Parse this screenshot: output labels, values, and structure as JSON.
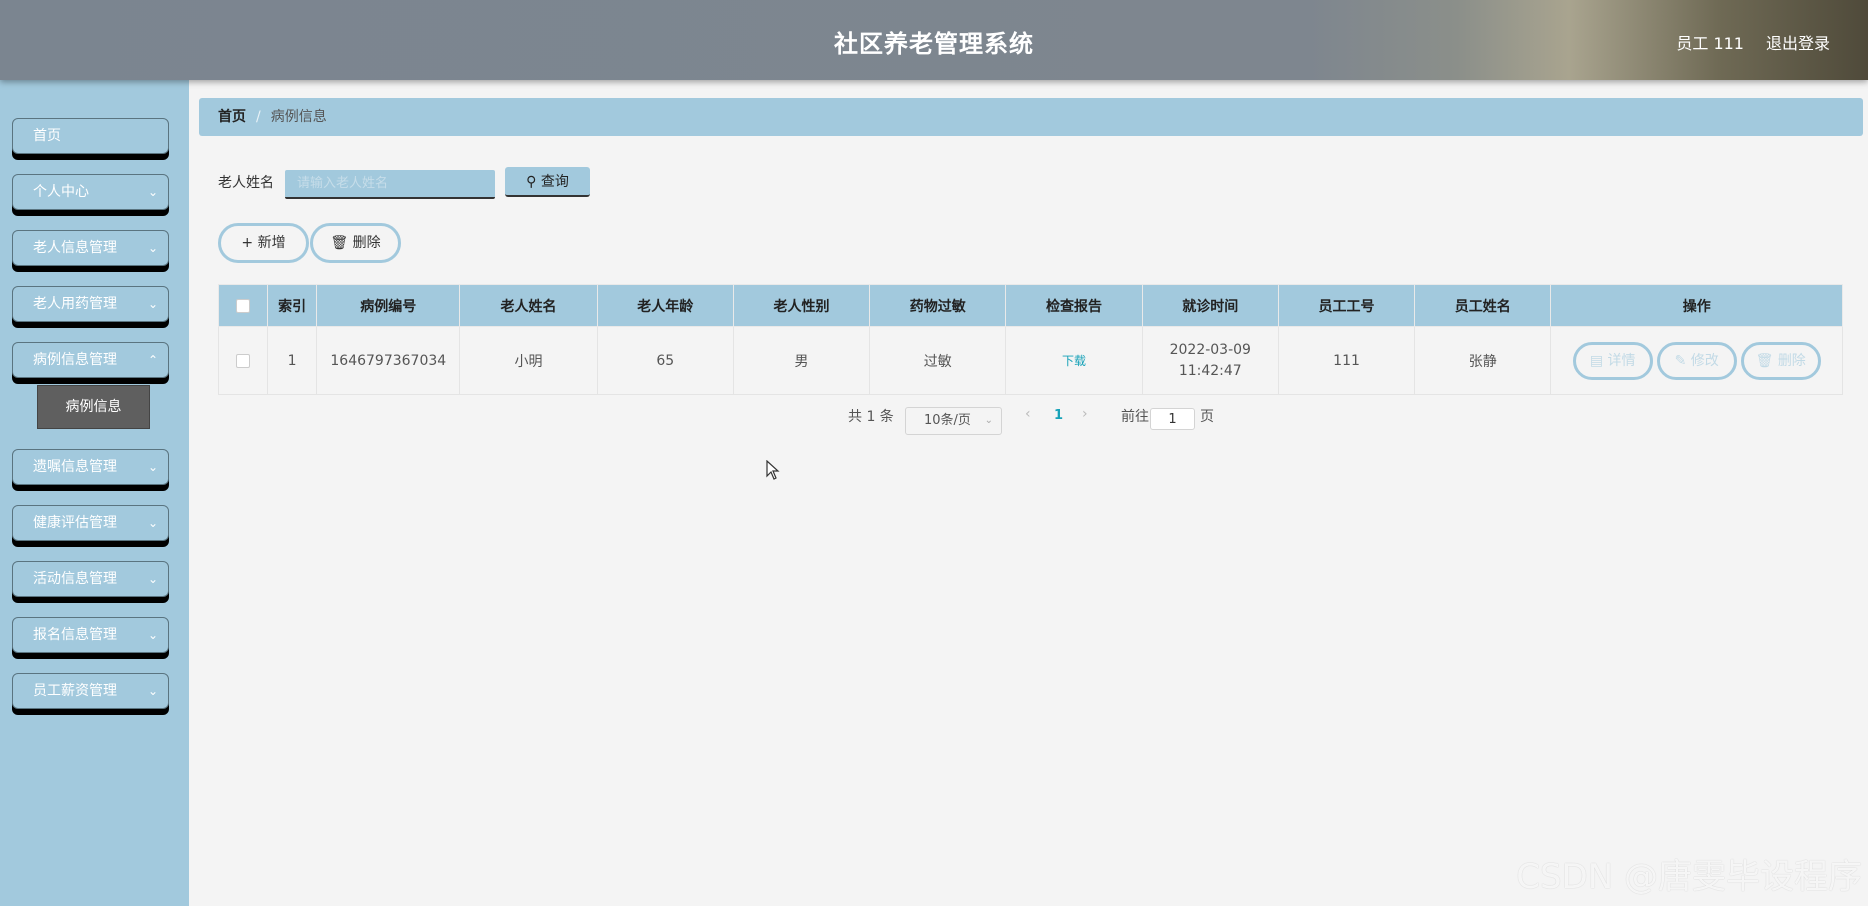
{
  "header": {
    "title": "社区养老管理系统",
    "user": "员工 111",
    "logout": "退出登录"
  },
  "sidebar": {
    "items": [
      {
        "label": "首页"
      },
      {
        "label": "个人中心"
      },
      {
        "label": "老人信息管理"
      },
      {
        "label": "老人用药管理"
      },
      {
        "label": "病例信息管理"
      },
      {
        "label": "遗嘱信息管理"
      },
      {
        "label": "健康评估管理"
      },
      {
        "label": "活动信息管理"
      },
      {
        "label": "报名信息管理"
      },
      {
        "label": "员工薪资管理"
      }
    ],
    "sub_item": "病例信息"
  },
  "breadcrumb": {
    "home": "首页",
    "separator": "/",
    "current": "病例信息"
  },
  "search": {
    "label": "老人姓名",
    "placeholder": "请输入老人姓名",
    "button": "查询"
  },
  "actions": {
    "add": "新增",
    "delete": "删除"
  },
  "table": {
    "columns": [
      "索引",
      "病例编号",
      "老人姓名",
      "老人年龄",
      "老人性别",
      "药物过敏",
      "检查报告",
      "就诊时间",
      "员工工号",
      "员工姓名",
      "操作"
    ],
    "rows": [
      {
        "index": "1",
        "case_no": "1646797367034",
        "name": "小明",
        "age": "65",
        "gender": "男",
        "allergy": "过敏",
        "report": "下载",
        "visit_time": "2022-03-09 11:42:47",
        "staff_no": "111",
        "staff_name": "张静"
      }
    ],
    "row_actions": {
      "detail": "详情",
      "edit": "修改",
      "delete": "删除"
    }
  },
  "pagination": {
    "total": "共 1 条",
    "page_size": "10条/页",
    "current_page": "1",
    "goto_label": "前往",
    "goto_value": "1",
    "goto_suffix": "页"
  },
  "watermark": "CSDN @唐雯毕设程序",
  "colors": {
    "accent": "#a2c9dd",
    "header": "#7b8590",
    "link": "#17a2b8"
  }
}
